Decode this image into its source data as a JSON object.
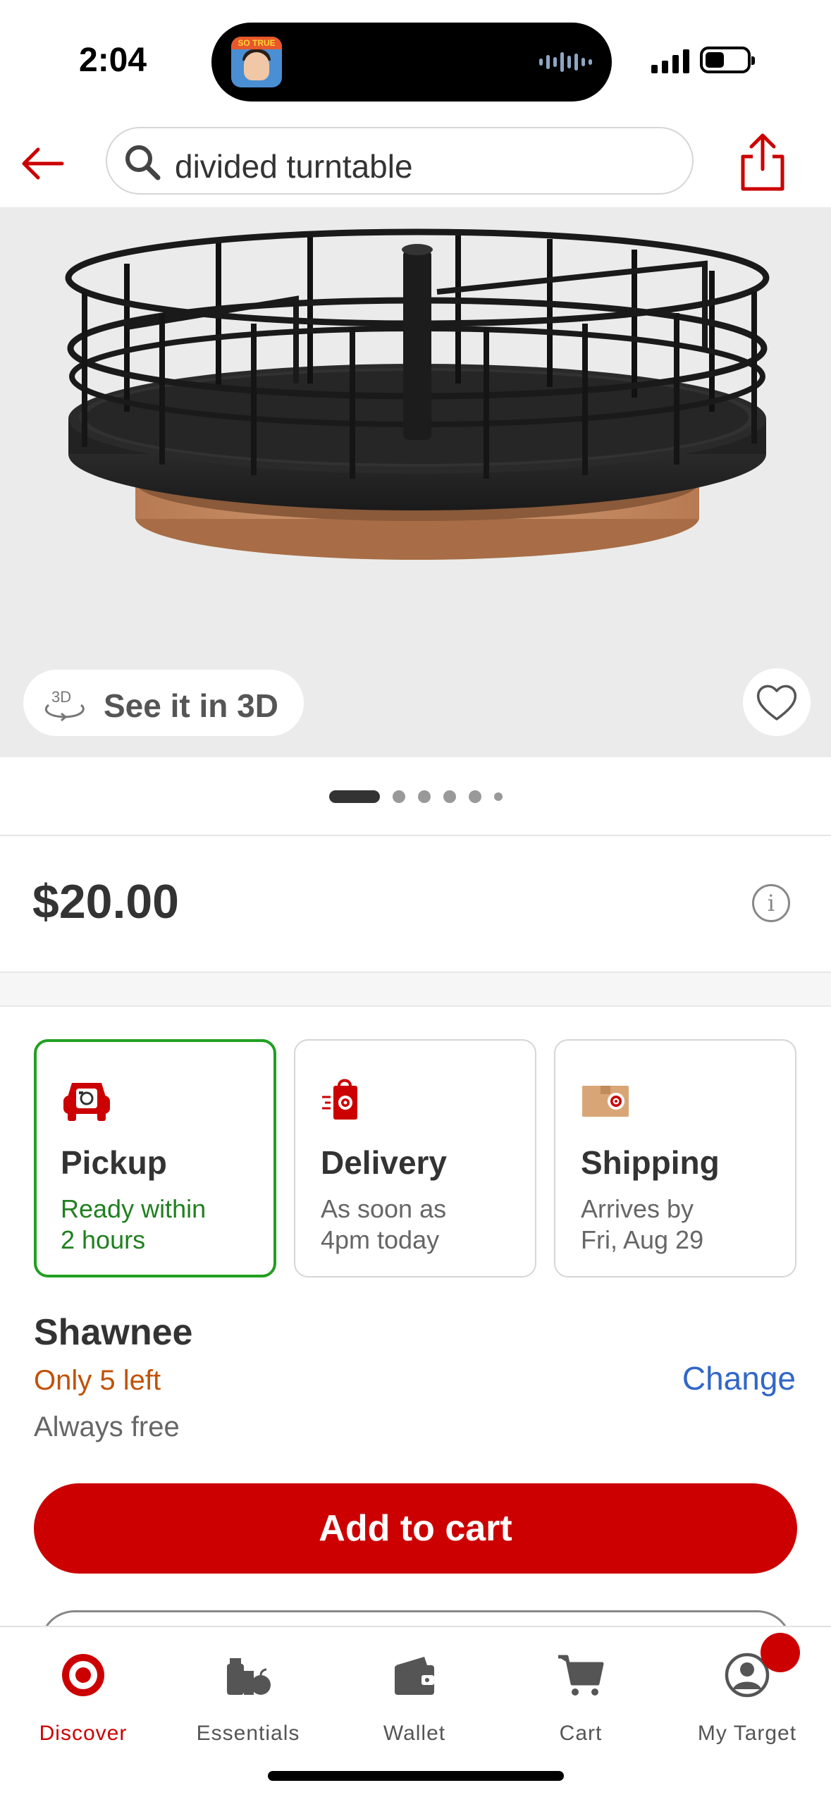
{
  "status_bar": {
    "time": "2:04",
    "live_activity_app_label": "SO TRUE"
  },
  "search": {
    "query": "divided turntable"
  },
  "product_image": {
    "see_3d_label": "See it in 3D",
    "see_3d_badge": "3D",
    "carousel_total": 6,
    "carousel_active_index": 0
  },
  "product": {
    "price": "$20.00",
    "info_glyph": "i"
  },
  "fulfillment": [
    {
      "title": "Pickup",
      "line1": "Ready within",
      "line2": "2 hours",
      "selected": true,
      "icon": "pickup-car-icon"
    },
    {
      "title": "Delivery",
      "line1": "As soon as",
      "line2": "4pm today",
      "selected": false,
      "icon": "delivery-bag-icon"
    },
    {
      "title": "Shipping",
      "line1": "Arrives by",
      "line2": "Fri, Aug 29",
      "selected": false,
      "icon": "shipping-box-icon"
    }
  ],
  "store": {
    "name": "Shawnee",
    "stock": "Only 5 left",
    "change_label": "Change",
    "note": "Always free"
  },
  "cart": {
    "add_label": "Add to cart"
  },
  "bottom_nav": [
    {
      "label": "Discover",
      "icon": "target-logo-icon",
      "active": true
    },
    {
      "label": "Essentials",
      "icon": "essentials-icon",
      "active": false
    },
    {
      "label": "Wallet",
      "icon": "wallet-icon",
      "active": false
    },
    {
      "label": "Cart",
      "icon": "cart-icon",
      "active": false
    },
    {
      "label": "My Target",
      "icon": "account-icon",
      "active": false
    }
  ],
  "colors": {
    "brand_red": "#cc0000",
    "selected_green": "#21a021",
    "link_blue": "#3167c8",
    "stock_orange": "#c05208"
  }
}
